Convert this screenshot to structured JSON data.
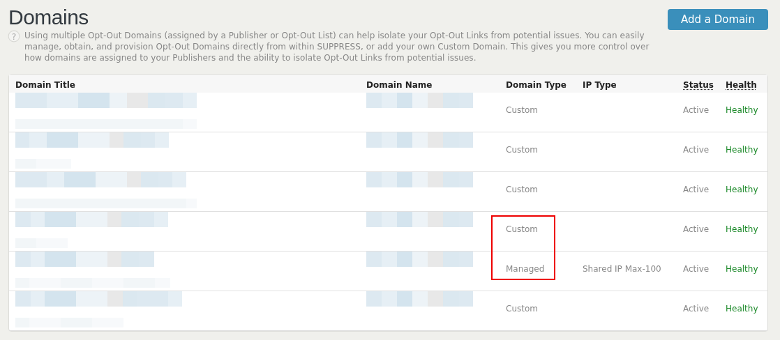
{
  "page": {
    "title": "Domains",
    "help_icon": "?",
    "help_text": "Using multiple Opt-Out Domains (assigned by a Publisher or Opt-Out List) can help isolate your Opt-Out Links from potential issues. You can easily manage, obtain, and provision Opt-Out Domains directly from within SUPPRESS, or add your own Custom Domain. This gives you more control over how domains are assigned to your Publishers and the ability to isolate Opt-Out Links from potential issues."
  },
  "buttons": [
    {
      "label": "Add a Domain"
    }
  ],
  "table": {
    "columns": [
      {
        "label": "Domain Title"
      },
      {
        "label": "Domain Name"
      },
      {
        "label": "Domain Type"
      },
      {
        "label": "IP Type"
      },
      {
        "label": "Status",
        "hint": true
      },
      {
        "label": "Health",
        "hint": true
      }
    ],
    "rows": [
      {
        "title_redacted": true,
        "name_redacted": true,
        "domain_type": "Custom",
        "status": "Active",
        "health": "Healthy"
      },
      {
        "title_redacted": true,
        "name_redacted": true,
        "domain_type": "Custom",
        "status": "Active",
        "health": "Healthy"
      },
      {
        "title_redacted": true,
        "name_redacted": true,
        "domain_type": "Custom",
        "status": "Active",
        "health": "Healthy"
      },
      {
        "title_redacted": true,
        "name_redacted": true,
        "domain_type": "Custom",
        "status": "Active",
        "health": "Healthy",
        "highlighted": true
      },
      {
        "title_redacted": true,
        "name_redacted": true,
        "domain_type": "Managed",
        "ip_type": "Shared IP Max-100",
        "status": "Active",
        "health": "Healthy",
        "highlighted": true
      },
      {
        "title_redacted": true,
        "name_redacted": true,
        "domain_type": "Custom",
        "status": "Active",
        "health": "Healthy"
      }
    ]
  }
}
